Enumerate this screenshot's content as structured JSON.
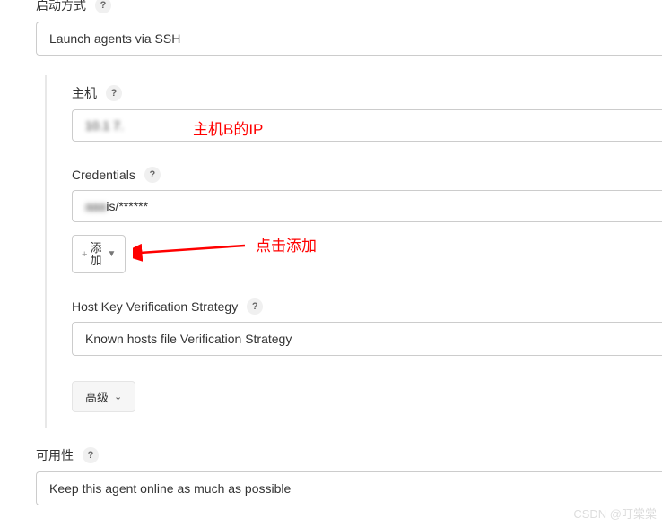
{
  "launch_method": {
    "label": "启动方式",
    "value": "Launch agents via SSH"
  },
  "ssh": {
    "host": {
      "label": "主机",
      "value": "10.1     7."
    },
    "credentials": {
      "label": "Credentials",
      "value": "   is/******"
    },
    "add_button": "添加",
    "strategy": {
      "label": "Host Key Verification Strategy",
      "value": "Known hosts file Verification Strategy"
    },
    "advanced": "高级"
  },
  "availability": {
    "label": "可用性",
    "value": "Keep this agent online as much as possible"
  },
  "annotations": {
    "host_ip": "主机B的IP",
    "click_add": "点击添加"
  },
  "help_char": "?",
  "watermark": "CSDN @叮棠棠"
}
